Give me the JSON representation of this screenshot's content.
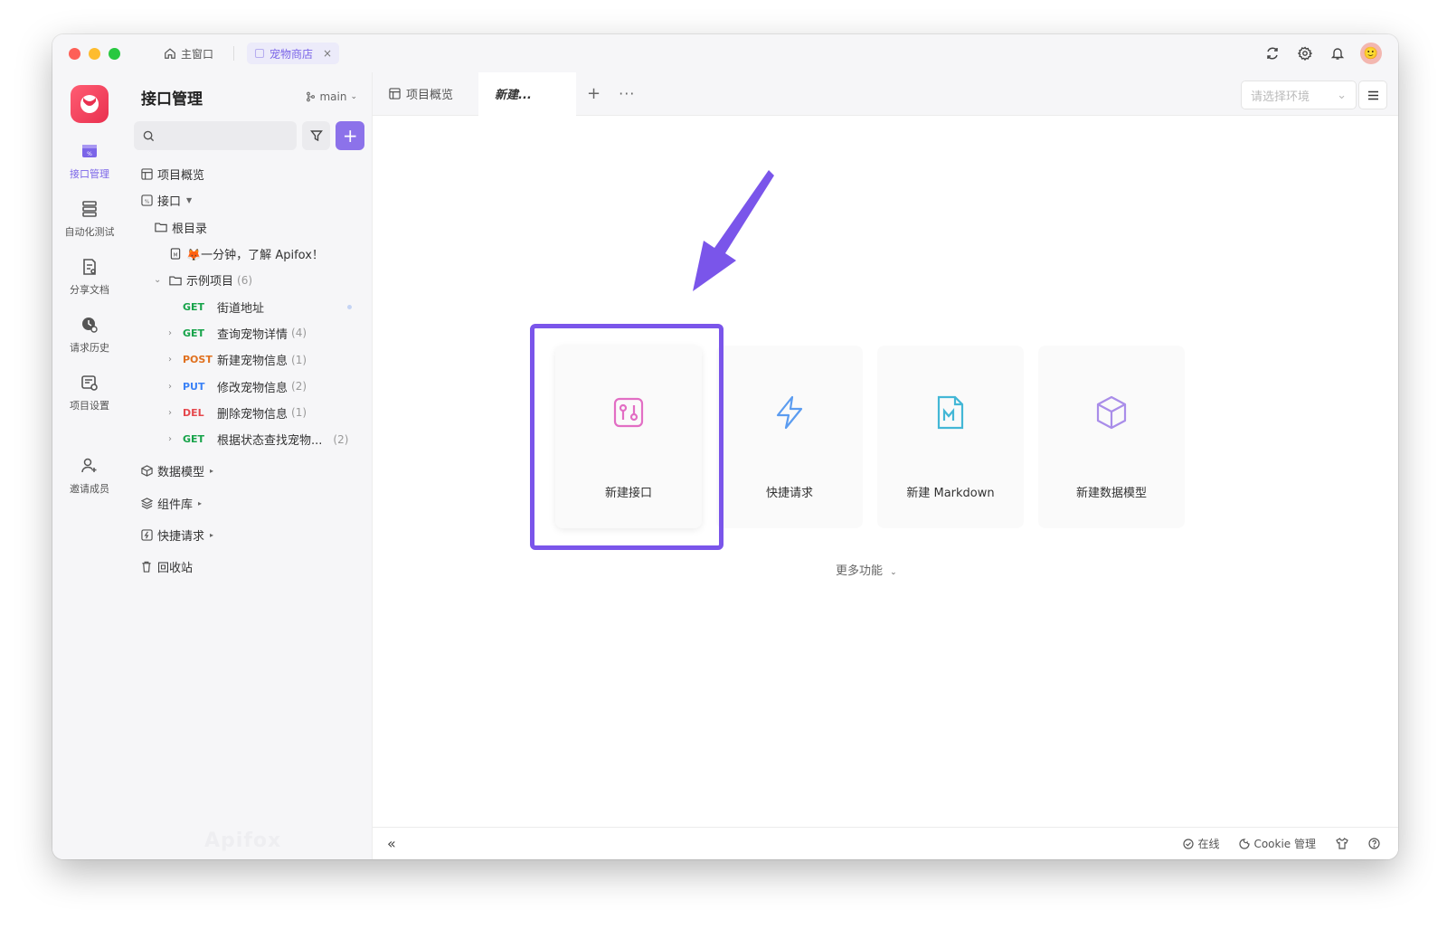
{
  "titlebar": {
    "tabs": [
      {
        "label": "主窗口",
        "active": false
      },
      {
        "label": "宠物商店",
        "active": true
      }
    ]
  },
  "rail": {
    "items": [
      {
        "label": "接口管理",
        "active": true
      },
      {
        "label": "自动化测试",
        "active": false
      },
      {
        "label": "分享文档",
        "active": false
      },
      {
        "label": "请求历史",
        "active": false
      },
      {
        "label": "项目设置",
        "active": false
      },
      {
        "label": "邀请成员",
        "active": false
      }
    ]
  },
  "tree": {
    "title": "接口管理",
    "branch": "main",
    "search_placeholder": "",
    "overview": "项目概览",
    "interfaces": "接口",
    "root": "根目录",
    "doc": "🦊一分钟，了解 Apifox！",
    "folder": {
      "label": "示例项目",
      "count": "(6)"
    },
    "endpoints": [
      {
        "method": "GET",
        "label": "街道地址",
        "count": ""
      },
      {
        "method": "GET",
        "label": "查询宠物详情",
        "count": "(4)"
      },
      {
        "method": "POST",
        "label": "新建宠物信息",
        "count": "(1)"
      },
      {
        "method": "PUT",
        "label": "修改宠物信息",
        "count": "(2)"
      },
      {
        "method": "DEL",
        "label": "删除宠物信息",
        "count": "(1)"
      },
      {
        "method": "GET",
        "label": "根据状态查找宠物...",
        "count": "(2)"
      }
    ],
    "data_models": "数据模型",
    "components": "组件库",
    "quick_requests": "快捷请求",
    "trash": "回收站",
    "watermark": "Apifox"
  },
  "main": {
    "tabs": [
      {
        "label": "项目概览"
      },
      {
        "label": "新建..."
      }
    ],
    "env_placeholder": "请选择环境",
    "cards": [
      {
        "label": "新建接口",
        "icon": "api-icon",
        "color": "#e26ec4"
      },
      {
        "label": "快捷请求",
        "icon": "lightning-icon",
        "color": "#5b9cf0"
      },
      {
        "label": "新建 Markdown",
        "icon": "markdown-icon",
        "color": "#43b7d6"
      },
      {
        "label": "新建数据模型",
        "icon": "cube-icon",
        "color": "#a98de9"
      }
    ],
    "more": "更多功能",
    "highlight_color": "#7a55ea"
  },
  "statusbar": {
    "online": "在线",
    "cookie": "Cookie 管理"
  }
}
